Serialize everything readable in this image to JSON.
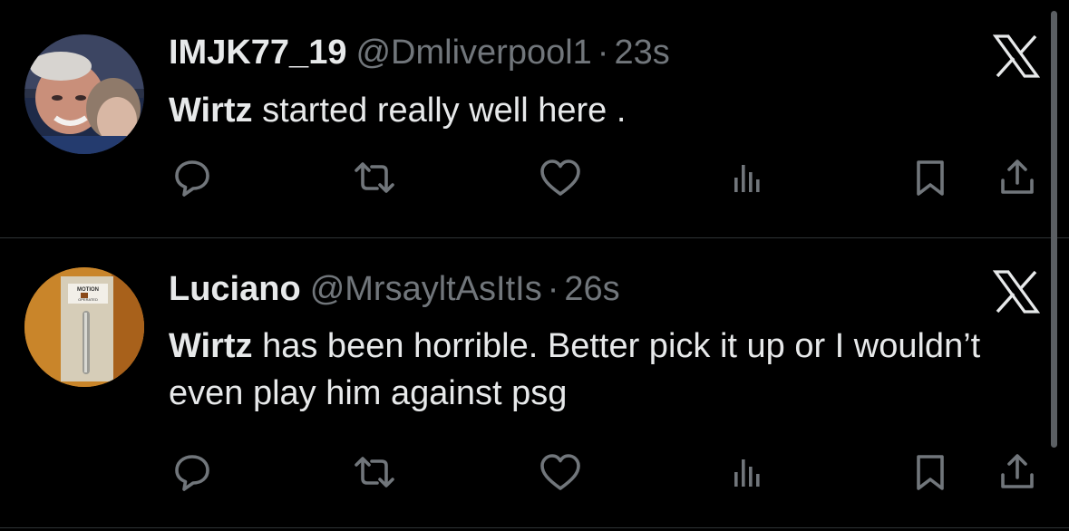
{
  "tweets": [
    {
      "display_name": "IMJK77_19",
      "handle": "@Dmliverpool1",
      "separator": "·",
      "time": "23s",
      "text_bold": "Wirtz",
      "text_rest": " started really well here ."
    },
    {
      "display_name": "Luciano",
      "handle": "@MrsayltAsItIs",
      "separator": "·",
      "time": "26s",
      "text_bold": "Wirtz",
      "text_rest": " has been horrible. Better pick it up or I wouldn’t even play him against psg"
    }
  ],
  "avatar_sign": {
    "line1": "MOTION",
    "line2": "OPERATED"
  },
  "colors": {
    "background": "#000000",
    "text_primary": "#e7e9ea",
    "text_secondary": "#71767b",
    "divider": "#2f3336",
    "icon": "#71767b"
  },
  "icons": [
    "reply-icon",
    "retweet-icon",
    "like-icon",
    "views-icon",
    "bookmark-icon",
    "share-icon",
    "x-logo-icon"
  ]
}
